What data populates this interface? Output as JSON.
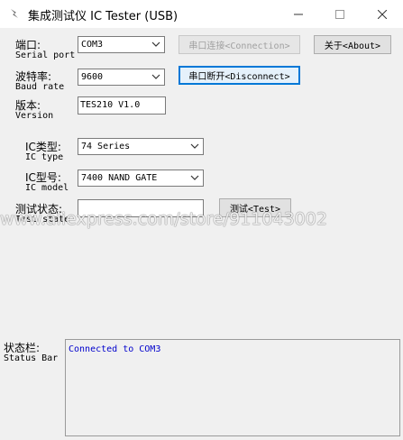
{
  "window": {
    "title": "集成测试仪 IC Tester (USB)",
    "controls": {
      "minimize": "—",
      "maximize": "☐",
      "close": "✕"
    }
  },
  "serial_port": {
    "label": "端口:",
    "sub_label": "Serial port",
    "value": "COM3"
  },
  "baud_rate": {
    "label": "波特率:",
    "sub_label": "Baud rate",
    "value": "9600"
  },
  "version": {
    "label": "版本:",
    "sub_label": "Version",
    "value": "TES210 V1.0"
  },
  "ic_type": {
    "label": "IC类型:",
    "sub_label": "IC type",
    "value": "74 Series"
  },
  "ic_model": {
    "label": "IC型号:",
    "sub_label": "IC model",
    "value": "7400 NAND GATE"
  },
  "test_state": {
    "label": "测试状态:",
    "sub_label": "Test state",
    "value": ""
  },
  "buttons": {
    "connect": "串口连接<Connection>",
    "about": "关于<About>",
    "disconnect": "串口断开<Disconnect>",
    "test": "测试<Test>"
  },
  "watermark": "www.aliexpress.com/store/911043002",
  "status_bar": {
    "label": "状态栏:",
    "sub_label": "Status Bar",
    "message": "Connected to COM3"
  },
  "colors": {
    "status_text": "#0000cc",
    "focus_border": "#0078d7"
  }
}
